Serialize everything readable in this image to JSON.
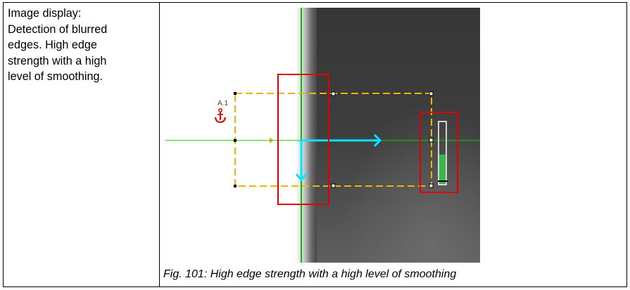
{
  "description": {
    "lines": [
      "Image display:",
      "Detection of blurred",
      "edges. High edge",
      "strength with a high",
      "level of smoothing."
    ]
  },
  "figure": {
    "anchor_label": "A.1",
    "anchor_icon": "anchor-icon",
    "edge_strength_level": 0.48,
    "colors": {
      "image_edge_green": "#00c000",
      "scan_line": "#00d000",
      "roi_border": "#f0b400",
      "highlight_box": "#e00000",
      "arrow": "#00e6ff",
      "anchor": "#cc1a1a",
      "edge_bar_fill": "#3ab54a",
      "background_dark": "#3a3a3a"
    }
  },
  "caption": {
    "text": "Fig. 101: High edge strength with a high level of smoothing"
  }
}
